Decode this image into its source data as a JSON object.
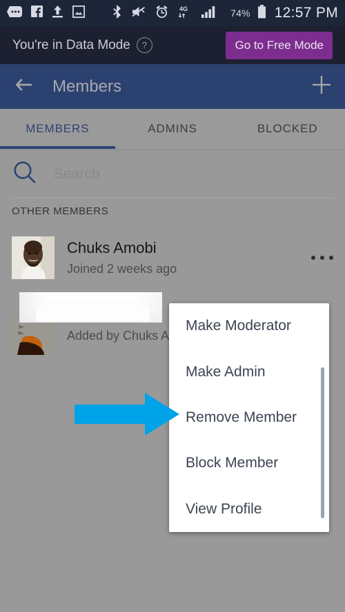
{
  "status_bar": {
    "icons": [
      "messenger-icon",
      "facebook-icon",
      "upload-icon",
      "photo-icon",
      "bluetooth-icon",
      "vibrate-off-icon",
      "alarm-icon",
      "network-4g-icon",
      "signal-bars-icon"
    ],
    "network_label": "4G",
    "battery_percent": "74%",
    "time": "12:57 PM",
    "background_color": "#1d2539",
    "foreground_color": "#d6d9e3"
  },
  "banner": {
    "message": "You're in Data Mode",
    "help_icon": "question-mark-icon",
    "button_label": "Go to Free Mode",
    "button_color": "#7d2d8f",
    "background_color": "#1c2030"
  },
  "appbar": {
    "back_icon": "back-arrow-icon",
    "title": "Members",
    "add_icon": "plus-icon",
    "background_color": "#2b4170"
  },
  "tabs": {
    "items": [
      {
        "label": "MEMBERS",
        "active": true
      },
      {
        "label": "ADMINS",
        "active": false
      },
      {
        "label": "BLOCKED",
        "active": false
      }
    ],
    "active_color": "#2d4373"
  },
  "search": {
    "icon": "search-icon",
    "placeholder": "Search",
    "value": ""
  },
  "list": {
    "section_label": "OTHER MEMBERS",
    "members": [
      {
        "name": "Chuks Amobi",
        "subtitle": "Joined 2 weeks ago",
        "avatar": "photo-avatar",
        "overflow_icon": "more-options-icon"
      },
      {
        "name": "",
        "subtitle": "Added by Chuks Amo",
        "avatar": "photo-avatar",
        "overflow_icon": "more-options-icon"
      }
    ]
  },
  "context_menu": {
    "items": [
      {
        "label": "Make Moderator"
      },
      {
        "label": "Make Admin"
      },
      {
        "label": "Remove Member"
      },
      {
        "label": "Block Member"
      },
      {
        "label": "View Profile"
      }
    ],
    "scrollbar": "vertical-scrollbar"
  },
  "annotation": {
    "arrow": "right-pointing-arrow",
    "arrow_color": "#00a2e8",
    "points_at": "Remove Member"
  },
  "overlay": {
    "dim_color": "#999999"
  }
}
